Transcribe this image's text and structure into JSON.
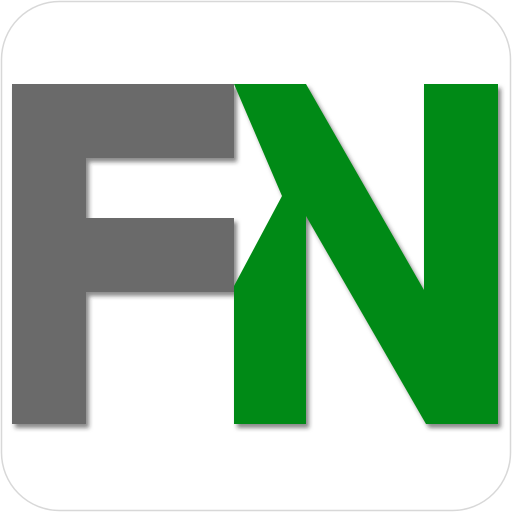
{
  "logo": {
    "text": "FN",
    "letters": [
      {
        "char": "F",
        "color": "#6a6a6a"
      },
      {
        "char": "N",
        "color": "#058a12"
      }
    ]
  },
  "colors": {
    "background": "#ffffff",
    "border": "#d8d8d8",
    "f_letter": "#6a6a6a",
    "n_letter": "#058a12",
    "shadow": "#3a3a3a"
  }
}
